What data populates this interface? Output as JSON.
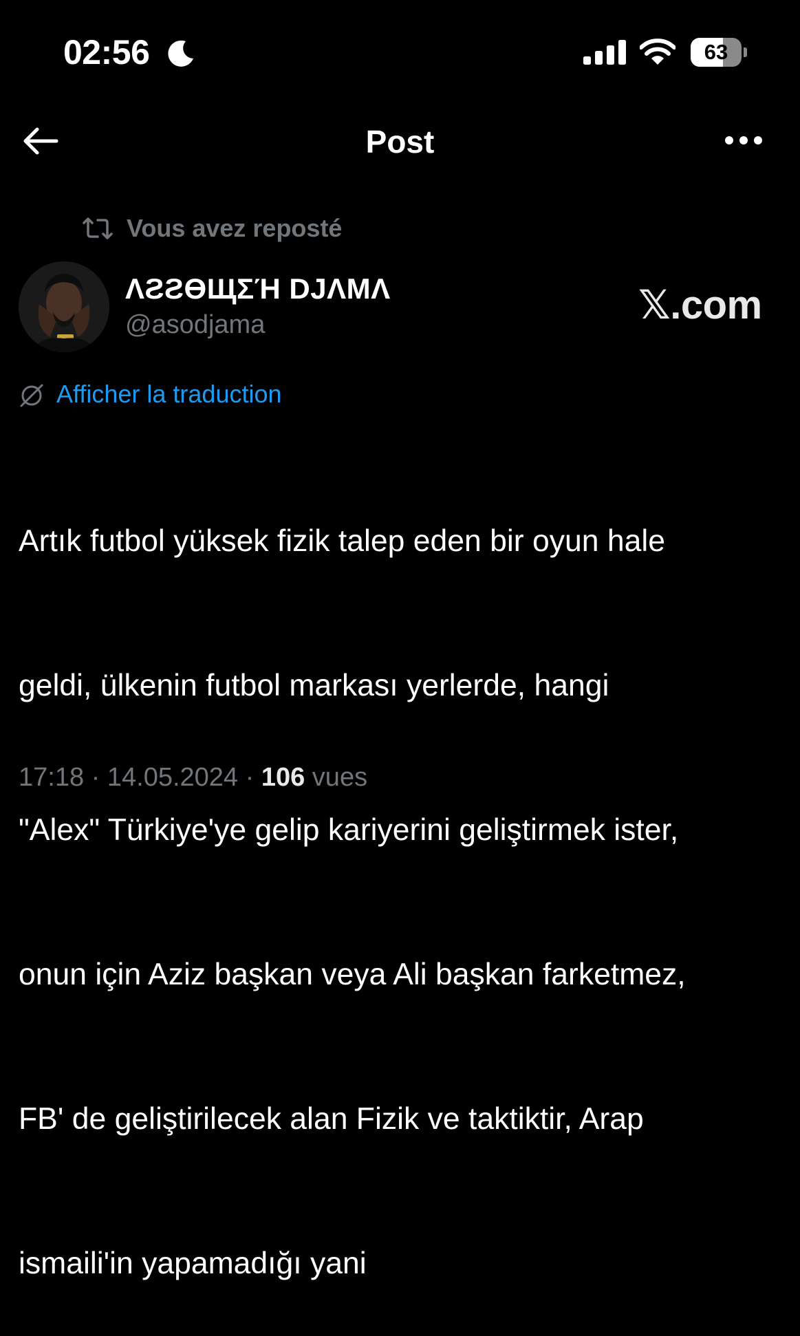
{
  "status_bar": {
    "time": "02:56",
    "battery_level": "63",
    "battery_fraction": 0.63,
    "icons": [
      "moon-icon",
      "signal-icon",
      "wifi-icon",
      "battery-icon"
    ]
  },
  "header": {
    "title": "Post",
    "back_icon": "arrow-left-icon",
    "more_icon": "ellipsis-icon"
  },
  "repost": {
    "icon": "repost-icon",
    "label": "Vous avez reposté"
  },
  "author": {
    "display_name": "ΛƧƧӨЩΣΉ DJΛMΛ",
    "handle": "@asodjama"
  },
  "watermark": "𝕏.com",
  "translation": {
    "icon": "globe-icon",
    "label": "Afficher la traduction"
  },
  "tweet": {
    "lines": [
      "Artık futbol yüksek fizik talep eden bir oyun hale",
      "geldi, ülkenin futbol markası yerlerde, hangi",
      "\"Alex\" Türkiye'ye gelip kariyerini geliştirmek ister,",
      "onun için Aziz başkan veya Ali başkan farketmez,",
      "FB' de geliştirilecek alan Fizik ve taktiktir, Arap",
      "ismaili'in yapamadığı  yani"
    ]
  },
  "meta": {
    "time": "17:18",
    "separator": " · ",
    "date": "14.05.2024",
    "views_count": "106",
    "views_label": " vues"
  },
  "colors": {
    "background": "#000000",
    "text": "#ffffff",
    "secondary": "#71767b",
    "link": "#1d9bf0"
  }
}
